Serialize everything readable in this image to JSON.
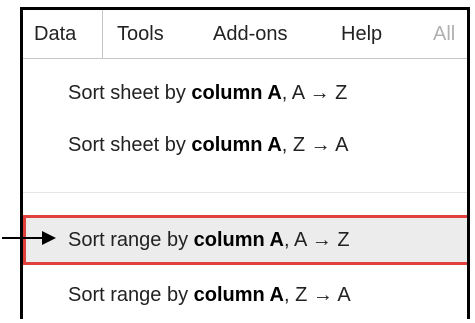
{
  "menubar": {
    "tabs": [
      {
        "label": "Data"
      },
      {
        "label": "Tools"
      },
      {
        "label": "Add-ons"
      },
      {
        "label": "Help"
      },
      {
        "label": "All"
      }
    ]
  },
  "menu": {
    "items": [
      {
        "prefix": "Sort sheet by ",
        "bold": "column A",
        "suffix": ", A → Z"
      },
      {
        "prefix": "Sort sheet by ",
        "bold": "column A",
        "suffix": ", Z → A"
      },
      {
        "prefix": "Sort range by ",
        "bold": "column A",
        "suffix": ", A → Z"
      },
      {
        "prefix": "Sort range by ",
        "bold": "column A",
        "suffix": ", Z → A"
      }
    ]
  },
  "colors": {
    "highlight_border": "#e0413c",
    "highlight_fill": "#ececec",
    "pointer_arrow": "#000000"
  },
  "annotations": {
    "pointer": "arrow-pointing-right"
  }
}
